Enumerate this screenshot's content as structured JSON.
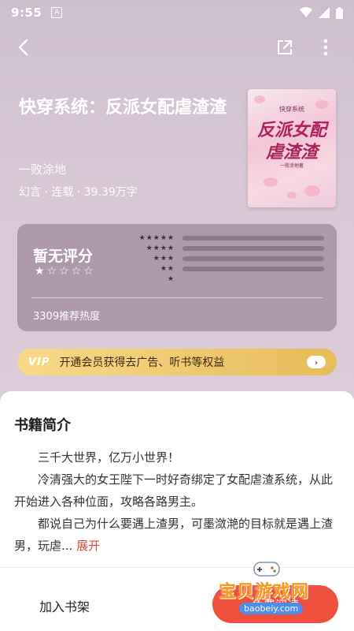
{
  "status_bar": {
    "time": "9:55",
    "notif_icon": "A"
  },
  "top_bar": {
    "back_icon": "back-icon",
    "share_icon": "share-icon",
    "more_icon": "more-icon"
  },
  "book": {
    "title": "快穿系统：反派女配虐渣渣",
    "author": "一败涂地",
    "meta": "幻言 · 连载 · 39.39万字",
    "cover": {
      "top": "快穿系统",
      "line1": "反派女配",
      "line2": "虐渣渣",
      "sub": "一败涂地著"
    }
  },
  "rating": {
    "label": "暂无评分",
    "stars_display": "★☆☆☆☆",
    "distribution": [
      {
        "stars": "★★★★★"
      },
      {
        "stars": "★★★★"
      },
      {
        "stars": "★★★"
      },
      {
        "stars": "★★"
      },
      {
        "stars": "★"
      }
    ],
    "heat": "3309推荐热度"
  },
  "vip": {
    "badge": "VIP",
    "text": "开通会员获得去广告、听书等权益",
    "arrow": "›"
  },
  "intro": {
    "title": "书籍简介",
    "p1": "三千大世界，亿万小世界！",
    "p2": "冷清强大的女王陛下一时好奇绑定了女配虐渣系统，从此开始进入各种位面，攻略各路男主。",
    "p3": "都说自己为什么要遇上渣男，可墨潋滟的目标就是遇上渣男，玩虐...",
    "expand": "展开"
  },
  "bottom": {
    "add_shelf": "加入书架",
    "read": "免费阅读"
  },
  "watermark": {
    "text": "宝贝游戏网",
    "url": "baobeiy.com"
  },
  "colors": {
    "accent": "#ef4f3d",
    "vip_gold": "#e7bb5a",
    "expand": "#e0473d"
  }
}
